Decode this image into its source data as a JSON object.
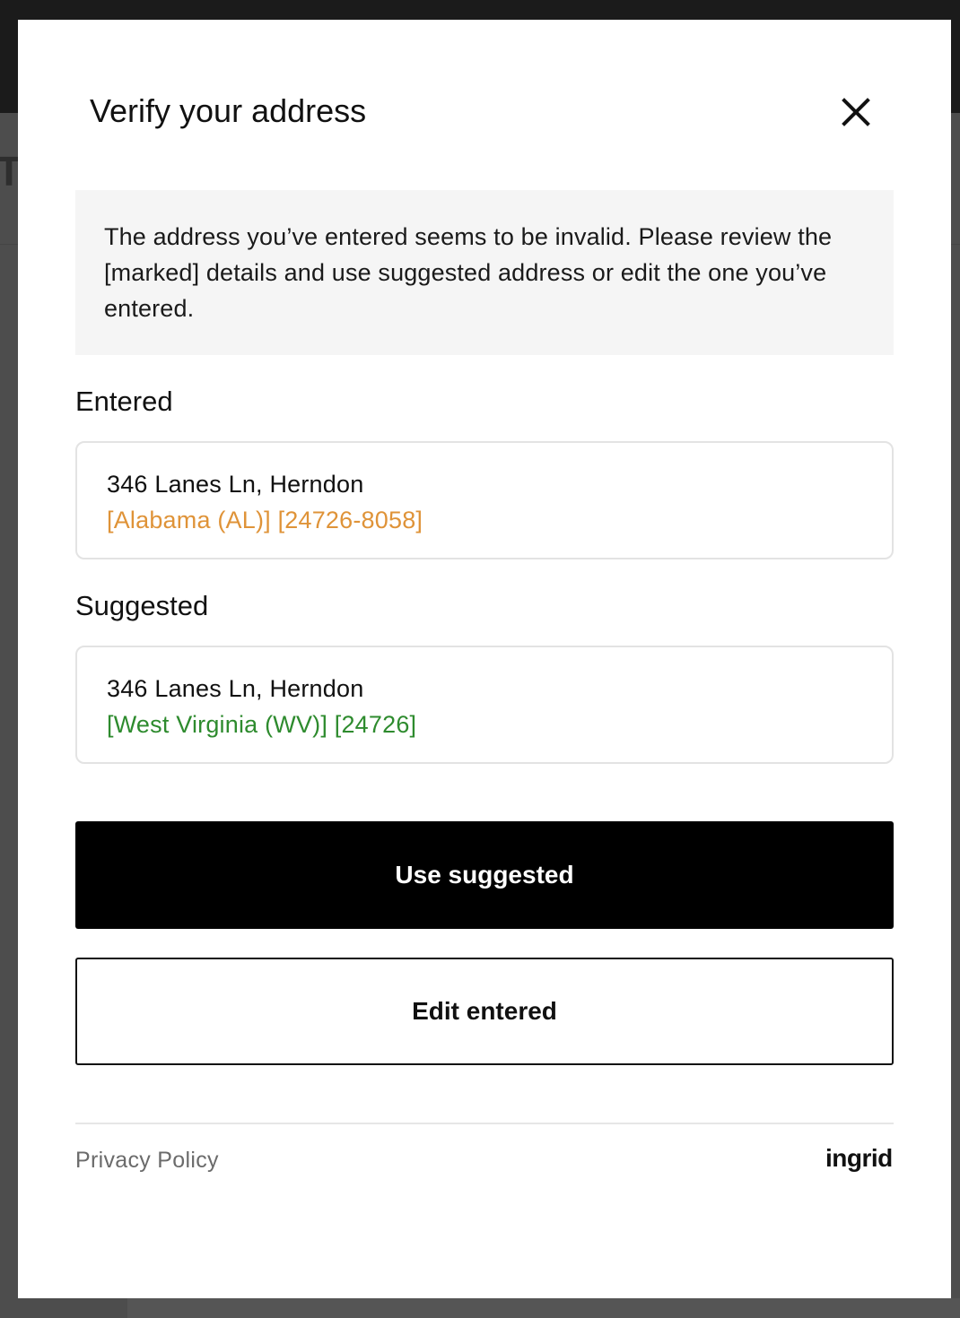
{
  "modal": {
    "title": "Verify your address",
    "notice": "The address you’ve entered seems to be invalid. Please review the [marked] details and use suggested address or edit the one you’ve entered."
  },
  "entered": {
    "label": "Entered",
    "line1": "346 Lanes Ln, Herndon",
    "line2": "[Alabama (AL)] [24726-8058]"
  },
  "suggested": {
    "label": "Suggested",
    "line1": "346 Lanes Ln, Herndon",
    "line2": "[West Virginia (WV)] [24726]"
  },
  "actions": {
    "use_suggested": "Use suggested",
    "edit_entered": "Edit entered"
  },
  "footer": {
    "privacy": "Privacy Policy",
    "brand": "ingrid"
  },
  "colors": {
    "invalid": "#df9338",
    "valid": "#2e8b2e",
    "primary_button": "#000000"
  },
  "icons": {
    "close": "close-icon"
  }
}
